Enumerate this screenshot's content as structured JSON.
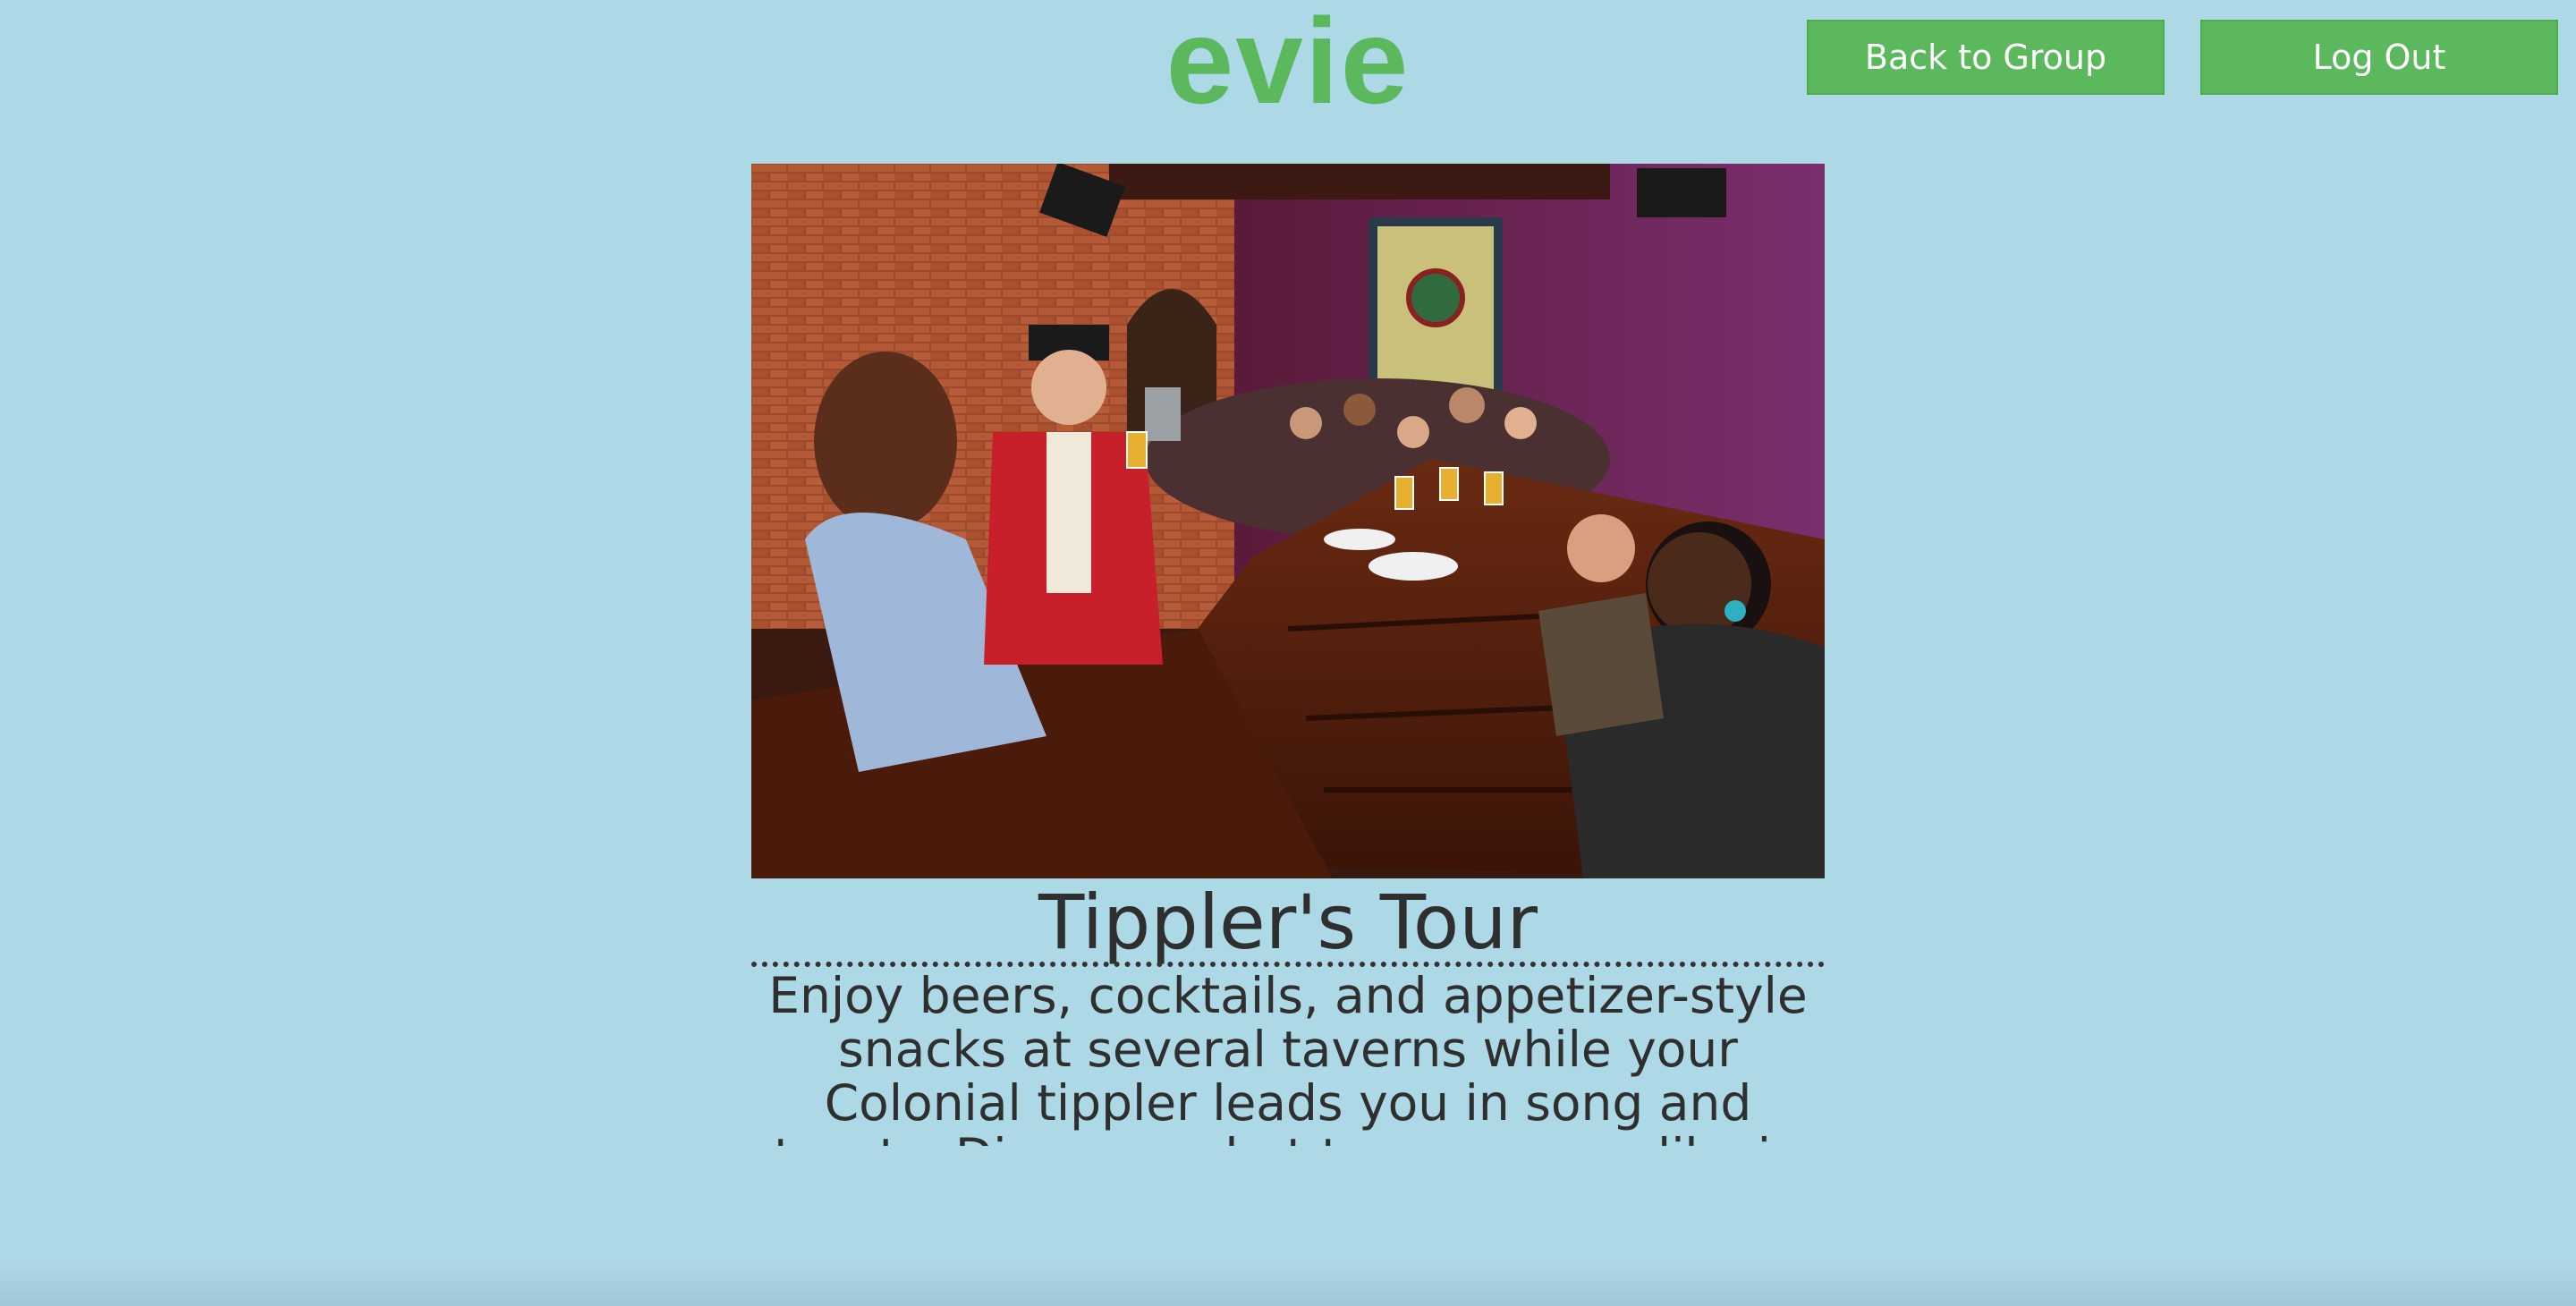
{
  "header": {
    "logo_text": "evie",
    "back_button_label": "Back to Group",
    "logout_button_label": "Log Out"
  },
  "event": {
    "title": "Tippler's Tour",
    "description": "Enjoy beers, cocktails, and appetizer-style snacks at several taverns while your Colonial tippler leads you in song and toasts. Discover what taverns were like in"
  },
  "colors": {
    "background": "#add8e6",
    "accent_green": "#5cb85c",
    "text": "#2f2f2f"
  },
  "icons": {
    "hero_image": "tavern-group-photo"
  }
}
